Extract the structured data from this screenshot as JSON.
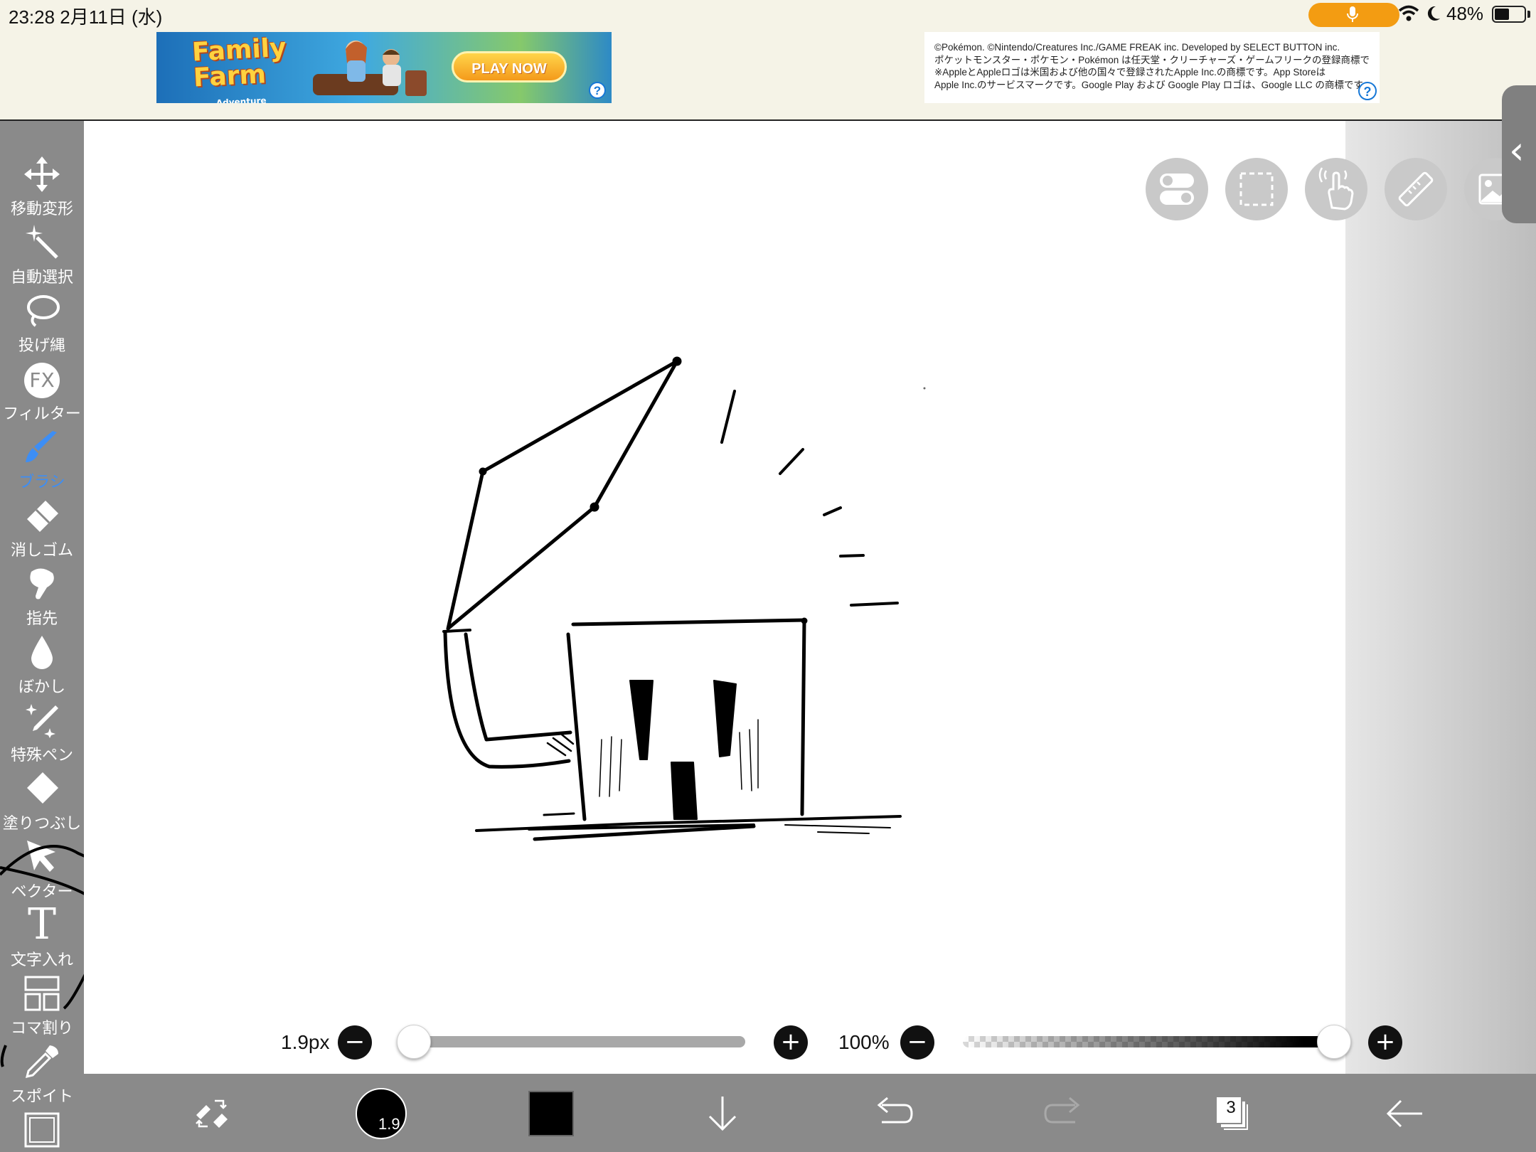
{
  "status_bar": {
    "time": "23:28   2月11日 (水)",
    "battery": "48%"
  },
  "ad": {
    "logo_line1": "Family",
    "logo_line2": "Farm",
    "logo_sub": "Adventure",
    "cta": "PLAY NOW",
    "help": "?"
  },
  "legal": {
    "lines": [
      "©Pokémon. ©Nintendo/Creatures Inc./GAME FREAK inc. Developed by SELECT BUTTON inc.",
      "ポケットモンスター・ポケモン・Pokémon は任天堂・クリーチャーズ・ゲームフリークの登録商標です。",
      "※AppleとAppleロゴは米国および他の国々で登録されたApple Inc.の商標です。App Storeは",
      "Apple Inc.のサービスマークです。Google Play および Google Play ロゴは、Google LLC の商標です。"
    ],
    "help": "?"
  },
  "sidebar": {
    "tools": [
      {
        "label": "移動変形",
        "icon": "move-transform-icon"
      },
      {
        "label": "自動選択",
        "icon": "magic-wand-icon"
      },
      {
        "label": "投げ縄",
        "icon": "lasso-icon"
      },
      {
        "label": "フィルター",
        "icon": "fx-filter-icon",
        "glyph": "FX"
      },
      {
        "label": "ブラシ",
        "icon": "brush-icon",
        "active": true
      },
      {
        "label": "消しゴム",
        "icon": "eraser-icon"
      },
      {
        "label": "指先",
        "icon": "finger-smudge-icon"
      },
      {
        "label": "ぼかし",
        "icon": "blur-drop-icon"
      },
      {
        "label": "特殊ペン",
        "icon": "special-pen-icon"
      },
      {
        "label": "塗りつぶし",
        "icon": "fill-bucket-icon"
      },
      {
        "label": "ベクター",
        "icon": "vector-cursor-icon"
      },
      {
        "label": "文字入れ",
        "icon": "text-icon",
        "glyph": "T"
      },
      {
        "label": "コマ割り",
        "icon": "panel-divide-icon"
      },
      {
        "label": "スポイト",
        "icon": "eyedropper-icon"
      }
    ]
  },
  "sliders": {
    "size_label": "1.9px",
    "size_value": 1.9,
    "opacity_label": "100%",
    "opacity_percent": 100,
    "minus": "−",
    "plus": "+"
  },
  "bottom_bar": {
    "brush_size": "1.9",
    "color": "#000000",
    "layer_count": "3"
  },
  "colors": {
    "toolbar_bg": "#8a8a8a",
    "accent": "#3d8ef5",
    "mic_pill": "#f39c12"
  }
}
